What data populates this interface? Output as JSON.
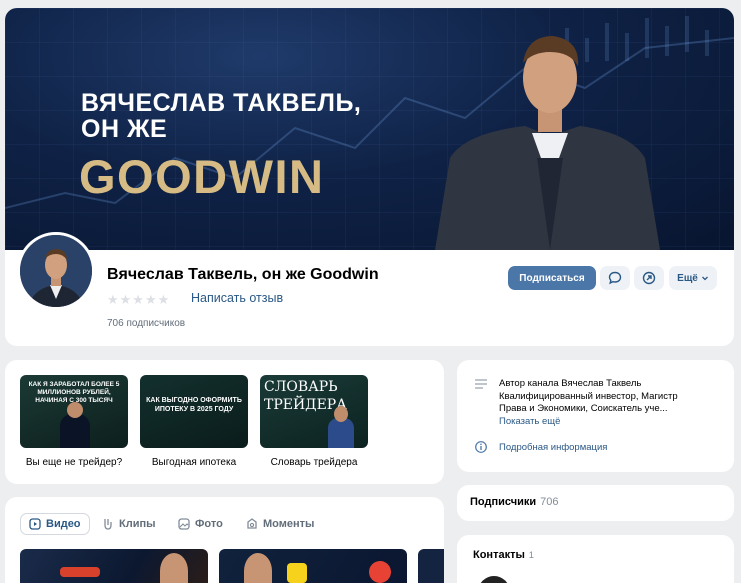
{
  "cover": {
    "line1": "ВЯЧЕСЛАВ ТАКВЕЛЬ,",
    "line2": "ОН ЖЕ",
    "big": "GOODWIN"
  },
  "profile": {
    "name": "Вячеслав Таквель, он же Goodwin",
    "rating_stars": "★★★★★",
    "review_link": "Написать отзыв",
    "subscribers": "706 подписчиков",
    "subscribe_button": "Подписаться",
    "more_button": "Ещё"
  },
  "playlists": [
    {
      "thumb_text": "КАК Я ЗАРАБОТАЛ БОЛЕЕ 5 МИЛЛИОНОВ РУБЛЕЙ, НАЧИНАЯ С 300 ТЫСЯЧ",
      "label": "Вы еще не трейдер?"
    },
    {
      "thumb_text": "КАК ВЫГОДНО ОФОРМИТЬ ИПОТЕКУ В 2025 ГОДУ",
      "label": "Выгодная ипотека"
    },
    {
      "thumb_text": "СЛОВАРЬ ТРЕЙДЕРА",
      "label": "Словарь трейдера"
    }
  ],
  "media_tabs": [
    "Видео",
    "Клипы",
    "Фото",
    "Моменты"
  ],
  "about": {
    "text": "Автор канала Вячеслав Таквель Квалифицированный инвестор, Магистр Права и Экономики, Соискатель уче...",
    "show_more": "Показать ещё",
    "details_link": "Подробная информация"
  },
  "sidebar": {
    "subscribers_title": "Подписчики",
    "subscribers_count": "706",
    "contacts_title": "Контакты",
    "contacts_count": "1"
  },
  "colors": {
    "accent": "#4a76a8",
    "link": "#2a5885",
    "gold": "#d6bc84",
    "background": "#edeef0"
  }
}
